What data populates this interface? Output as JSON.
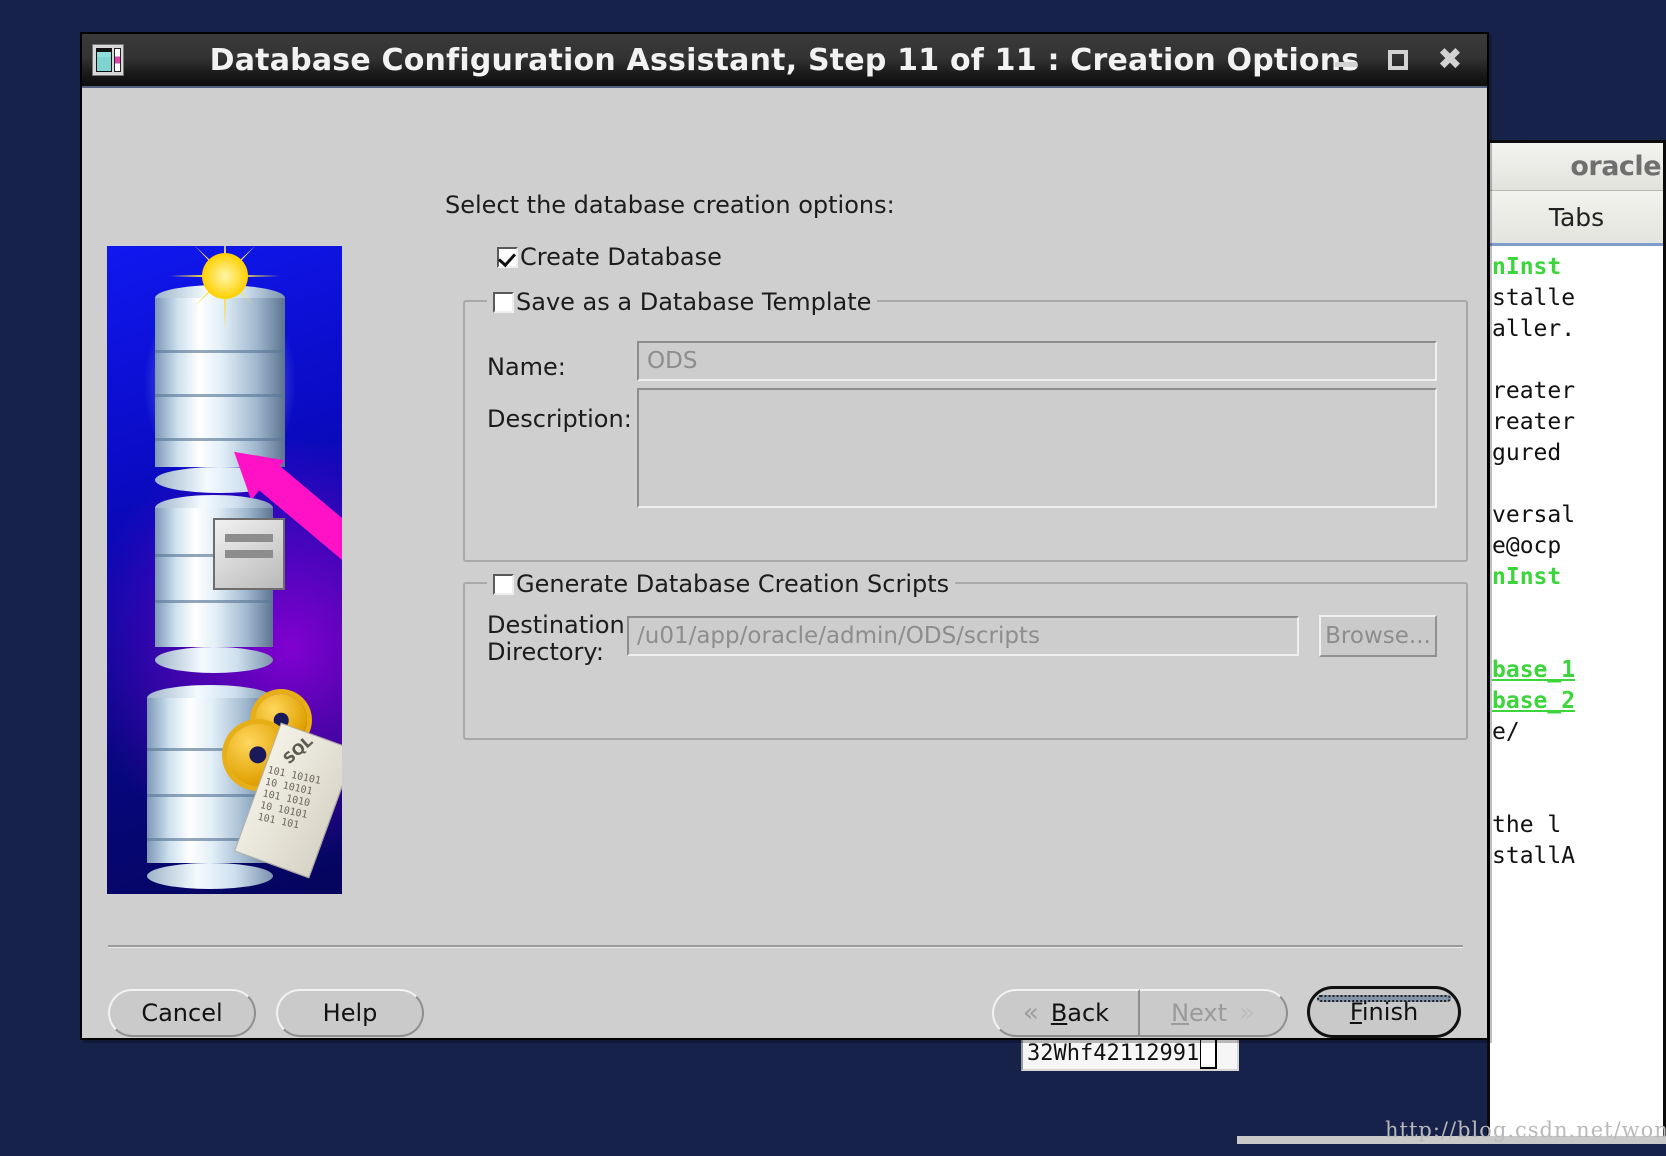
{
  "window": {
    "title": "Database Configuration Assistant, Step 11 of 11 : Creation Options",
    "icon": "database-app-icon",
    "controls": {
      "minimize": "minimize-icon",
      "maximize": "maximize-icon",
      "close": "close-icon"
    }
  },
  "form": {
    "intro": "Select the database creation options:",
    "create_database": {
      "label": "Create Database",
      "checked": true
    },
    "template_group": {
      "label": "Save as a Database Template",
      "checked": false,
      "name_label": "Name:",
      "name_value": "ODS",
      "description_label": "Description:",
      "description_value": ""
    },
    "scripts_group": {
      "label": "Generate Database Creation Scripts",
      "checked": false,
      "destination_label": "Destination Directory:",
      "destination_label_line1": "Destination",
      "destination_label_line2": "Directory:",
      "destination_value": "/u01/app/oracle/admin/ODS/scripts",
      "browse_label": "Browse..."
    }
  },
  "footer": {
    "cancel": "Cancel",
    "help": "Help",
    "back": "Back",
    "back_mnemonic": "B",
    "back_rest": "ack",
    "next": "Next",
    "next_mnemonic": "N",
    "next_rest": "ext",
    "finish": "Finish",
    "finish_mnemonic": "F",
    "finish_rest": "inish",
    "back_chevron": "«",
    "next_chevron": "»"
  },
  "terminal": {
    "title": "oracle",
    "menu": "Tabs",
    "lines": [
      {
        "text": "nInst",
        "color": "green"
      },
      {
        "text": "stalle",
        "color": "black"
      },
      {
        "text": "aller.",
        "color": "black"
      },
      {
        "text": "",
        "color": "black"
      },
      {
        "text": "reater",
        "color": "black"
      },
      {
        "text": "reater",
        "color": "black"
      },
      {
        "text": "gured",
        "color": "black"
      },
      {
        "text": "",
        "color": "black"
      },
      {
        "text": "versal",
        "color": "black"
      },
      {
        "text": "e@ocp",
        "color": "black"
      },
      {
        "text": "nInst",
        "color": "green"
      },
      {
        "text": "",
        "color": "black"
      },
      {
        "text": "",
        "color": "black"
      },
      {
        "text": "base_1",
        "color": "green-underline"
      },
      {
        "text": "base_2",
        "color": "green-underline"
      },
      {
        "text": "e/",
        "color": "black"
      },
      {
        "text": "",
        "color": "black"
      },
      {
        "text": "",
        "color": "black"
      },
      {
        "text": "the l",
        "color": "black"
      },
      {
        "text": "stallA",
        "color": "black"
      }
    ]
  },
  "bottom_field": {
    "value": "32Whf42112991"
  },
  "watermark": {
    "text": "http://blog.csdn.net/wonhf"
  },
  "colors": {
    "dialog_bg": "#cfcfcf",
    "titlebar": "#222222",
    "desktop": "#17224b",
    "terminal_green": "#3cd53c",
    "arrow_pink": "#ff12c6",
    "star_yellow": "#ffe21a"
  }
}
